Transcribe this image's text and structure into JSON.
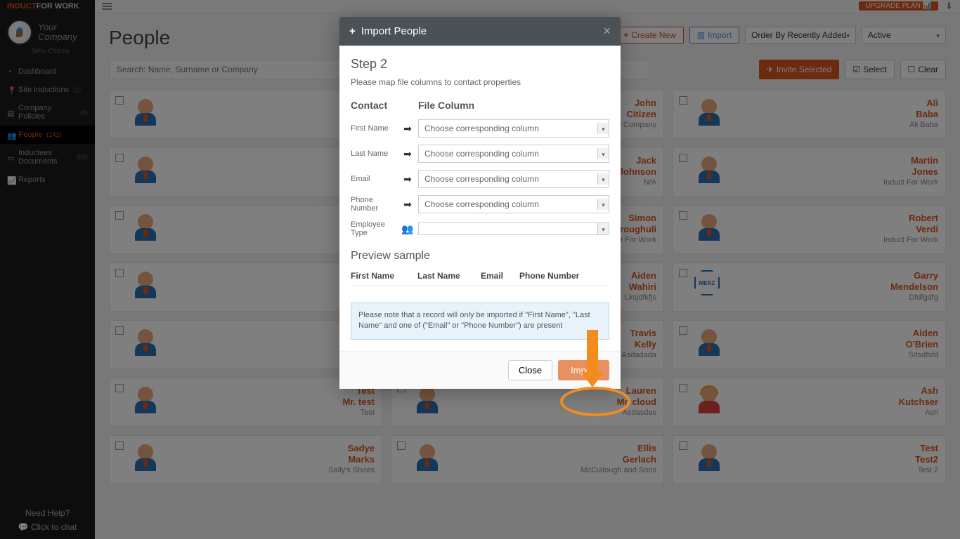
{
  "brand": {
    "part1": "INDUCT",
    "part2": "FOR WORK"
  },
  "company": {
    "name_l1": "Your",
    "name_l2": "Company",
    "user": "John Citizen"
  },
  "nav": {
    "dashboard": "Dashboard",
    "site": "Site Inductions",
    "site_badge": "(1)",
    "policies": "Company Policies",
    "policies_badge": "(4)",
    "people": "People",
    "people_badge": "(141)",
    "docs": "Inductees Documents",
    "docs_badge": "(65)",
    "reports": "Reports"
  },
  "sidebar_footer": {
    "help": "Need Help?",
    "chat": "Click to chat"
  },
  "topbar": {
    "upgrade": "UPGRADE PLAN"
  },
  "page": {
    "title": "People"
  },
  "actions": {
    "create": "Create New",
    "import": "Import",
    "order": "Order By Recently Added",
    "status": "Active",
    "invite": "Invite Selected",
    "select": "Select",
    "clear": "Clear"
  },
  "search": {
    "placeholder": "Search: Name, Surname or Company"
  },
  "people": [
    {
      "fn": "John",
      "ln": "Citizen",
      "co": "re Company"
    },
    {
      "fn": "Ali",
      "ln": "Baba",
      "co": "Ali Baba"
    },
    {
      "fn": "Jack",
      "ln": "Johnson",
      "co": "N/A"
    },
    {
      "fn": "Martin",
      "ln": "Jones",
      "co": "Induct For Work"
    },
    {
      "fn": "Simon",
      "ln": "Vroughuli",
      "co": "t For Work"
    },
    {
      "fn": "Robert",
      "ln": "Verdi",
      "co": "Induct For Work"
    },
    {
      "fn": "Aiden",
      "ln": "Wahiri",
      "co": "Lksjdfkfjs"
    },
    {
      "fn": "Garry",
      "ln": "Mendelson",
      "co": "Dfdfgdfg"
    },
    {
      "fn": "Travis",
      "ln": "Kelly",
      "co": "Asdadada"
    },
    {
      "fn": "Aiden",
      "ln": "O'Brien",
      "co": "Sdsdfsfd"
    },
    {
      "fn": "Test",
      "ln": "Mr. test",
      "co": "Test"
    },
    {
      "fn": "Lauren",
      "ln": "Mc cloud",
      "co": "Asdasdas"
    },
    {
      "fn": "Ash",
      "ln": "Kutchser",
      "co": "Ash"
    },
    {
      "fn": "Sadye",
      "ln": "Marks",
      "co": "Sally's Shoes"
    },
    {
      "fn": "Ellis",
      "ln": "Gerlach",
      "co": "McCullough and Sons"
    },
    {
      "fn": "Test",
      "ln": "Test2",
      "co": "Test 2"
    }
  ],
  "modal": {
    "title": "Import People",
    "step": "Step 2",
    "desc": "Please map file columns to contact properties",
    "col_contact": "Contact",
    "col_file": "File Column",
    "fields": {
      "first": "First Name",
      "last": "Last Name",
      "email": "Email",
      "phone_l1": "Phone",
      "phone_l2": "Number",
      "emp_l1": "Employee",
      "emp_l2": "Type"
    },
    "choose": "Choose corresponding column",
    "preview": "Preview sample",
    "preview_cols": {
      "fn": "First Name",
      "ln": "Last Name",
      "em": "Email",
      "ph": "Phone Number"
    },
    "note": "Please note that a record will only be imported if \"First Name\", \"Last Name\" and one of (\"Email\" or \"Phone Number\") are present",
    "close": "Close",
    "import": "Import"
  }
}
